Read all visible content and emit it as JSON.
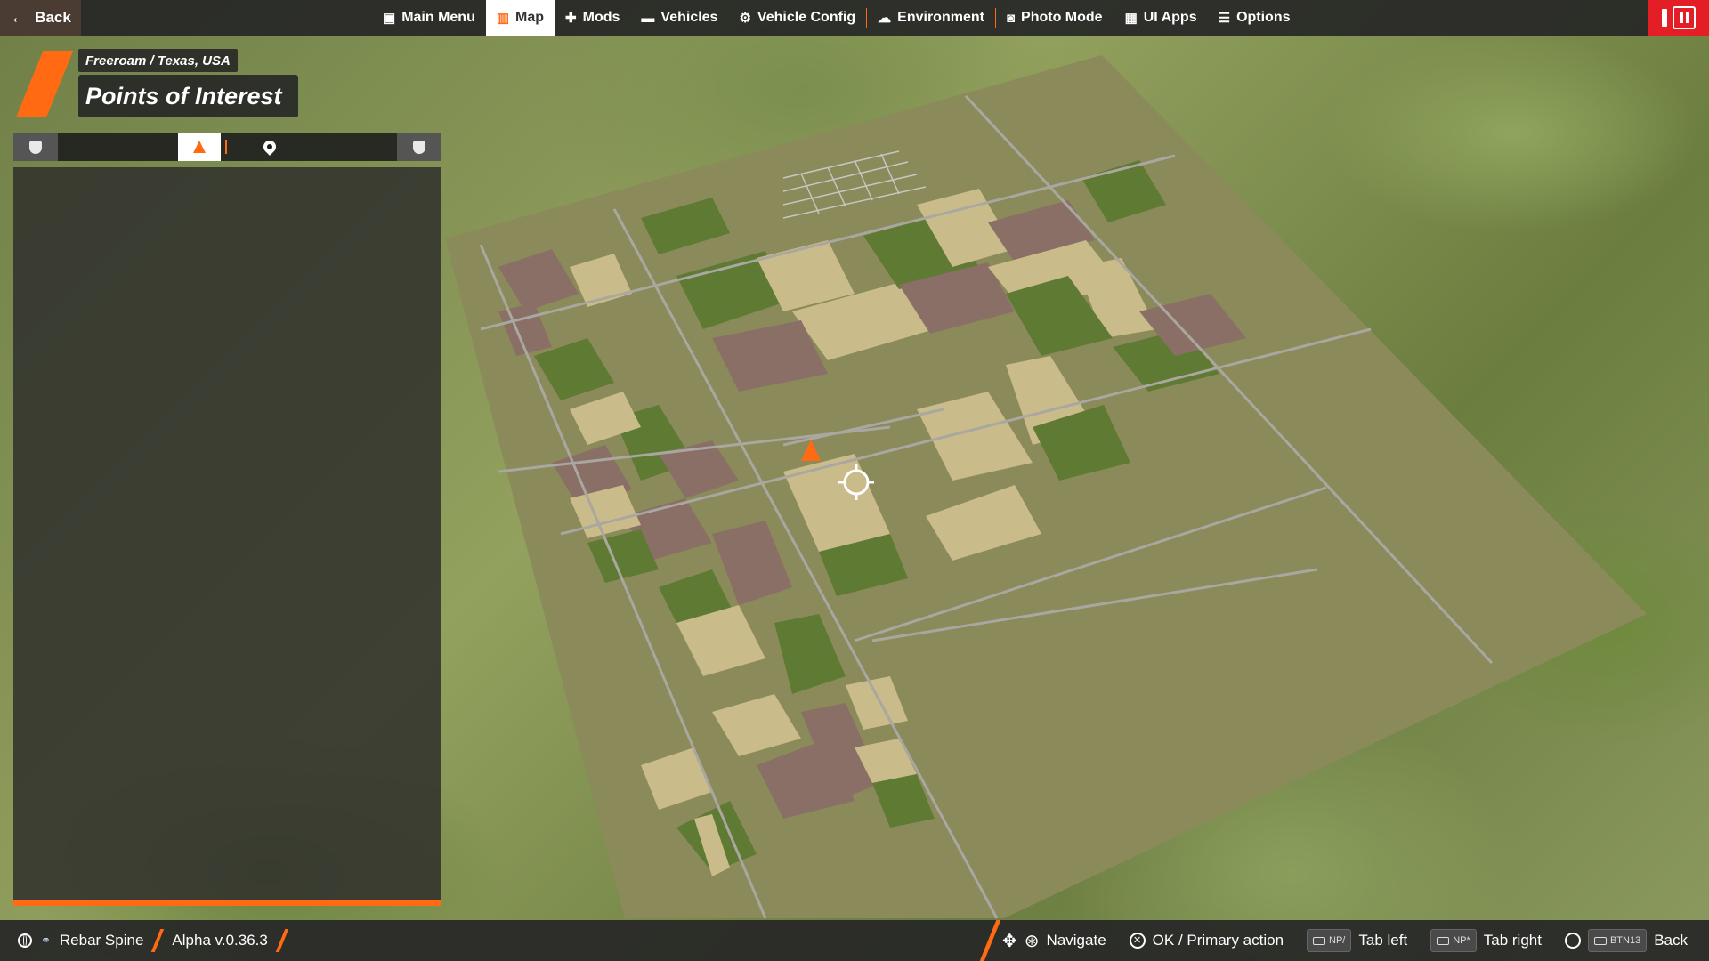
{
  "topbar": {
    "back_label": "Back",
    "nav": [
      {
        "label": "Main Menu",
        "icon": "main-menu-icon"
      },
      {
        "label": "Map",
        "icon": "map-icon",
        "active": true
      },
      {
        "label": "Mods",
        "icon": "puzzle-icon"
      },
      {
        "label": "Vehicles",
        "icon": "car-icon"
      },
      {
        "label": "Vehicle Config",
        "icon": "engine-icon"
      },
      {
        "label": "Environment",
        "icon": "weather-icon"
      },
      {
        "label": "Photo Mode",
        "icon": "camera-icon"
      },
      {
        "label": "UI Apps",
        "icon": "ui-apps-icon"
      },
      {
        "label": "Options",
        "icon": "sliders-icon"
      }
    ]
  },
  "header": {
    "breadcrumb": "Freeroam / Texas, USA",
    "title": "Points of Interest"
  },
  "tabs": {
    "active": "points-of-interest",
    "icons": [
      "shield-icon",
      "cone-icon",
      "pin-icon",
      "shield-icon"
    ]
  },
  "footer": {
    "user": "Rebar Spine",
    "version": "Alpha v.0.36.3",
    "hints": [
      {
        "label": "Navigate"
      },
      {
        "label": "OK / Primary action"
      },
      {
        "key": "NP/",
        "label": "Tab left"
      },
      {
        "key": "NP*",
        "label": "Tab right"
      },
      {
        "key": "BTN13",
        "label": "Back"
      }
    ]
  },
  "colors": {
    "accent": "#ff6a13",
    "pause": "#e31e24",
    "bar_bg": "#262626"
  }
}
